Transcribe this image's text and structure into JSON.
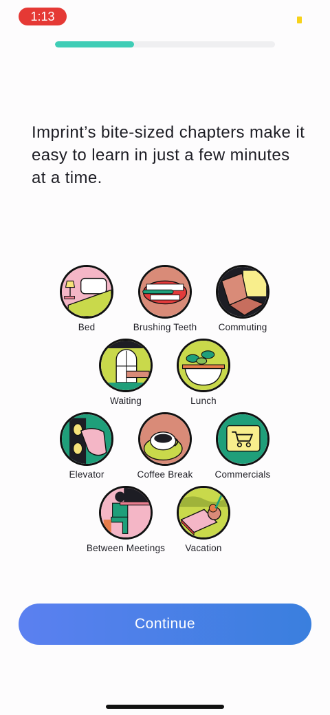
{
  "status": {
    "time": "1:13"
  },
  "progress": {
    "fraction": 0.36,
    "color": "#3fcdb6"
  },
  "headline": "Imprint’s bite-sized chapters make it easy to learn in just a few minutes at a time.",
  "moments": [
    {
      "label": "Bed",
      "icon": "bed-icon"
    },
    {
      "label": "Brushing Teeth",
      "icon": "teeth-icon"
    },
    {
      "label": "Commuting",
      "icon": "seat-icon"
    },
    {
      "label": "Waiting",
      "icon": "window-icon"
    },
    {
      "label": "Lunch",
      "icon": "salad-bowl-icon"
    },
    {
      "label": "Elevator",
      "icon": "elevator-button-icon"
    },
    {
      "label": "Coffee Break",
      "icon": "coffee-cup-icon"
    },
    {
      "label": "Commercials",
      "icon": "shopping-cart-icon"
    },
    {
      "label": "Between Meetings",
      "icon": "desk-person-icon"
    },
    {
      "label": "Vacation",
      "icon": "beach-drink-icon"
    }
  ],
  "cta": {
    "label": "Continue"
  }
}
